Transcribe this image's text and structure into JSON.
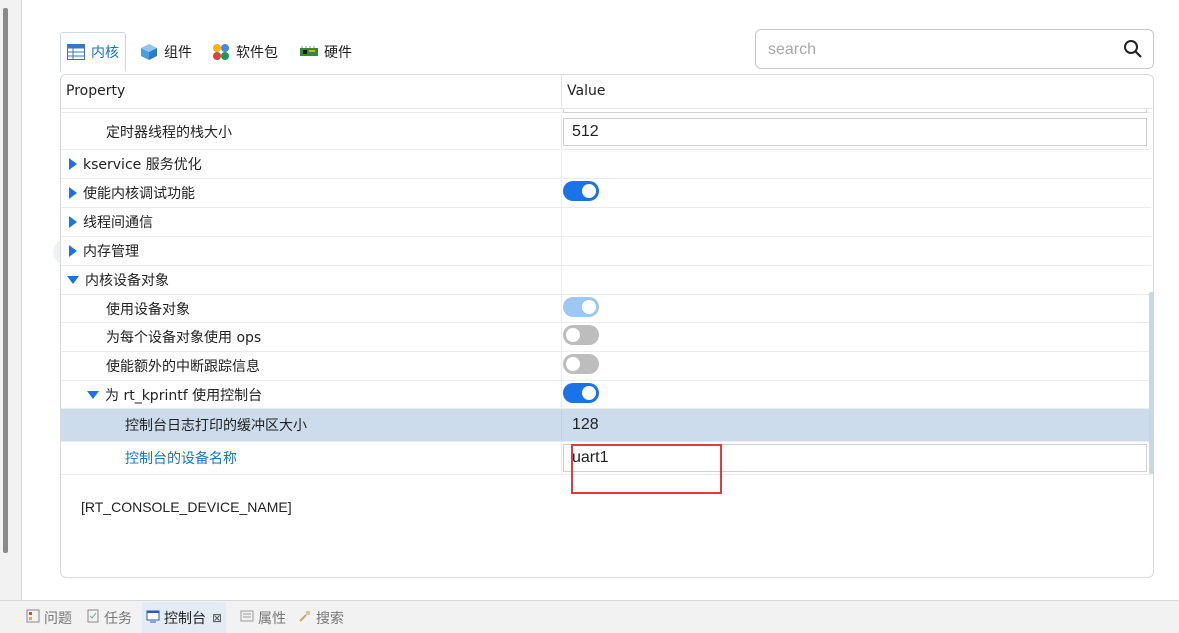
{
  "tabs": [
    {
      "label": "内核",
      "icon": "table-icon"
    },
    {
      "label": "组件",
      "icon": "cube-icon"
    },
    {
      "label": "软件包",
      "icon": "packages-icon"
    },
    {
      "label": "硬件",
      "icon": "board-icon"
    }
  ],
  "search": {
    "placeholder": "search"
  },
  "table": {
    "header_property": "Property",
    "header_value": "Value",
    "rows": [
      {
        "label": "定时器线程的栈大小",
        "value": "512"
      },
      {
        "label": "kservice 服务优化"
      },
      {
        "label": "使能内核调试功能",
        "toggle": "on"
      },
      {
        "label": "线程间通信"
      },
      {
        "label": "内存管理"
      },
      {
        "label": "内核设备对象"
      },
      {
        "label": "使用设备对象",
        "toggle": "on-disabled"
      },
      {
        "label": "为每个设备对象使用 ops",
        "toggle": "off"
      },
      {
        "label": "使能额外的中断跟踪信息",
        "toggle": "off"
      },
      {
        "label": "为 rt_kprintf 使用控制台",
        "toggle": "on"
      },
      {
        "label": "控制台日志打印的缓冲区大小",
        "value": "128"
      },
      {
        "label": "控制台的设备名称",
        "value": "uart1"
      }
    ]
  },
  "description": "[RT_CONSOLE_DEVICE_NAME]",
  "expand_label": "»",
  "bottom_tabs": [
    {
      "label": "问题",
      "icon": "problems-icon"
    },
    {
      "label": "任务",
      "icon": "tasks-icon"
    },
    {
      "label": "控制台",
      "icon": "console-icon",
      "close": "⊠"
    },
    {
      "label": "属性",
      "icon": "properties-icon"
    },
    {
      "label": "搜索",
      "icon": "search-icon"
    }
  ],
  "colors": {
    "accent": "#1a73e8",
    "selected_row": "#cddcec",
    "highlight_box": "#e23b3b",
    "link_label": "#1a73c8"
  }
}
